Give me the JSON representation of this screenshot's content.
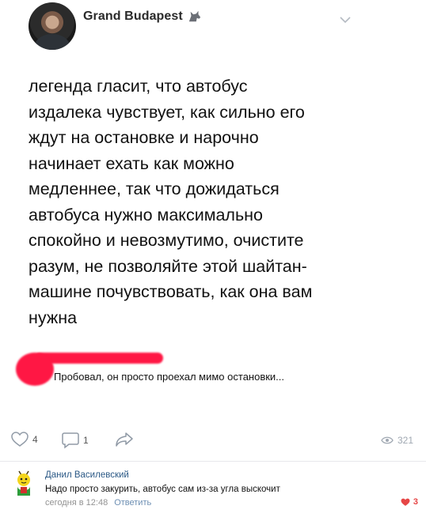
{
  "post": {
    "author": "Grand Budapest",
    "text": "легенда гласит, что автобус\nиздалека чувствует, как сильно его\nждут на остановке и нарочно\nначинает ехать как можно\nмедленнее, так что дожидаться\nавтобуса нужно максимально\nспокойно и невозмутимо, очистите\nразум, не позволяйте этой шайтан-\nмашине почувствовать, как она вам\nнужна",
    "caption": "Пробовал, он просто проехал мимо остановки..."
  },
  "actions": {
    "likes": "4",
    "comments": "1",
    "views": "321"
  },
  "comment": {
    "author": "Данил Василевский",
    "text": "Надо просто закурить, автобус сам из-за угла выскочит",
    "time": "сегодня в 12:48",
    "reply_label": "Ответить",
    "likes": "3"
  },
  "icons": {
    "author_badge": "wolf-icon",
    "menu": "chevron-down-icon",
    "like": "heart-icon",
    "comment": "comment-icon",
    "share": "share-icon",
    "views": "eye-icon",
    "comment_like": "heart-filled-icon"
  },
  "colors": {
    "link": "#2a5885",
    "reply": "#6d8fb3",
    "like_active": "#e64646",
    "muted": "#939393",
    "highlight": "#ff1744"
  }
}
